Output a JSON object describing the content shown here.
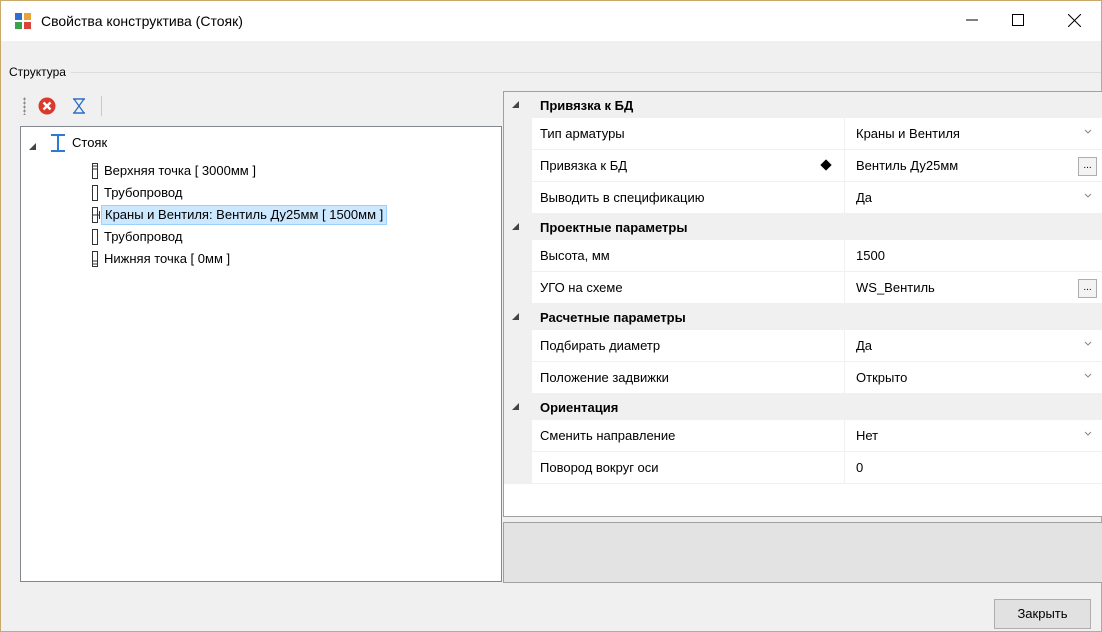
{
  "window": {
    "title": "Свойства конструктива (Стояк)",
    "icon": "app-window-icon",
    "controls": [
      "minimize-icon",
      "maximize-icon",
      "close-icon"
    ]
  },
  "structure": {
    "group_label": "Структура",
    "toolbar": {
      "delete_icon": "red-x-delete-icon",
      "filter_icon": "hourglass-filter-icon"
    },
    "tree": {
      "root": "Стояк",
      "children": [
        "Верхняя точка [ 3000мм ]",
        "Трубопровод",
        "Краны и Вентиля: Вентиль Ду25мм [ 1500мм ]",
        "Трубопровод",
        "Нижняя точка [ 0мм ]"
      ],
      "selected_index": 2
    }
  },
  "properties": {
    "categories": [
      {
        "name": "Привязка к БД",
        "rows": [
          {
            "name": "Тип арматуры",
            "value": "Краны и Вентиля",
            "editor": "dropdown"
          },
          {
            "name": "Привязка к БД",
            "value": "Вентиль Ду25мм",
            "editor": "ellipsis"
          },
          {
            "name": "Выводить в спецификацию",
            "value": "Да",
            "editor": "dropdown"
          }
        ]
      },
      {
        "name": "Проектные параметры",
        "rows": [
          {
            "name": "Высота, мм",
            "value": "1500",
            "editor": "text"
          },
          {
            "name": "УГО на схеме",
            "value": "WS_Вентиль",
            "editor": "ellipsis"
          }
        ]
      },
      {
        "name": "Расчетные параметры",
        "rows": [
          {
            "name": "Подбирать диаметр",
            "value": "Да",
            "editor": "dropdown"
          },
          {
            "name": "Положение задвижки",
            "value": "Открыто",
            "editor": "dropdown"
          }
        ]
      },
      {
        "name": "Ориентация",
        "rows": [
          {
            "name": "Сменить направление",
            "value": "Нет",
            "editor": "dropdown"
          },
          {
            "name": "Повород вокруг оси",
            "value": "0",
            "editor": "text"
          }
        ]
      }
    ],
    "ellipsis_label": "..."
  },
  "footer": {
    "close_label": "Закрыть"
  },
  "colors": {
    "selection_bg": "#cce8ff",
    "selection_border": "#99d1ff",
    "window_border": "#c8a96a"
  }
}
